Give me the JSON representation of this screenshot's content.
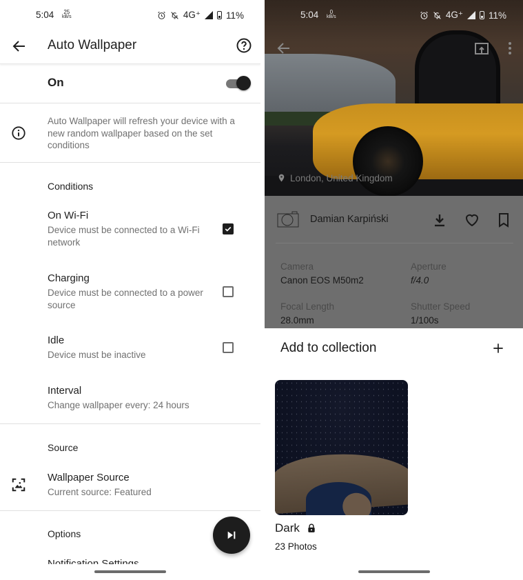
{
  "left": {
    "status_bar": {
      "time": "5:04",
      "speed_value": "25",
      "speed_unit": "kB/s",
      "network": "4G⁺",
      "battery": "11%"
    },
    "app_bar": {
      "title": "Auto Wallpaper",
      "back_icon": "arrow-left-icon",
      "help_icon": "help-circle-icon"
    },
    "master_switch": {
      "label": "On",
      "checked": true
    },
    "info_text": "Auto Wallpaper will refresh your device with a new random wallpaper based on the set conditions",
    "conditions": {
      "header": "Conditions",
      "items": [
        {
          "title": "On Wi-Fi",
          "subtitle": "Device must be connected to a Wi-Fi network",
          "checked": true
        },
        {
          "title": "Charging",
          "subtitle": "Device must be connected to a power source",
          "checked": false
        },
        {
          "title": "Idle",
          "subtitle": "Device must be inactive",
          "checked": false
        }
      ],
      "interval": {
        "title": "Interval",
        "subtitle": "Change wallpaper every: 24 hours"
      }
    },
    "source": {
      "header": "Source",
      "item": {
        "title": "Wallpaper Source",
        "subtitle": "Current source: Featured",
        "icon": "wallpaper-icon"
      }
    },
    "options": {
      "header": "Options",
      "first_item": "Notification Settings"
    },
    "fab": {
      "icon": "skip-next-icon"
    }
  },
  "right": {
    "status_bar": {
      "time": "5:04",
      "speed_value": "0",
      "speed_unit": "kB/s",
      "network": "4G⁺",
      "battery": "11%"
    },
    "photo": {
      "location": "London, United Kingdom",
      "author": "Damian Karpiński",
      "actions": [
        "download-icon",
        "heart-icon",
        "bookmark-icon"
      ],
      "exif": [
        {
          "label": "Camera",
          "value": "Canon  EOS M50m2"
        },
        {
          "label": "Aperture",
          "value": "f/4.0"
        },
        {
          "label": "Focal Length",
          "value": "28.0mm"
        },
        {
          "label": "Shutter Speed",
          "value": "1/100s"
        }
      ]
    },
    "sheet": {
      "title": "Add to collection",
      "collections": [
        {
          "name": "Dark",
          "count": "23 Photos",
          "private": true
        }
      ]
    }
  }
}
